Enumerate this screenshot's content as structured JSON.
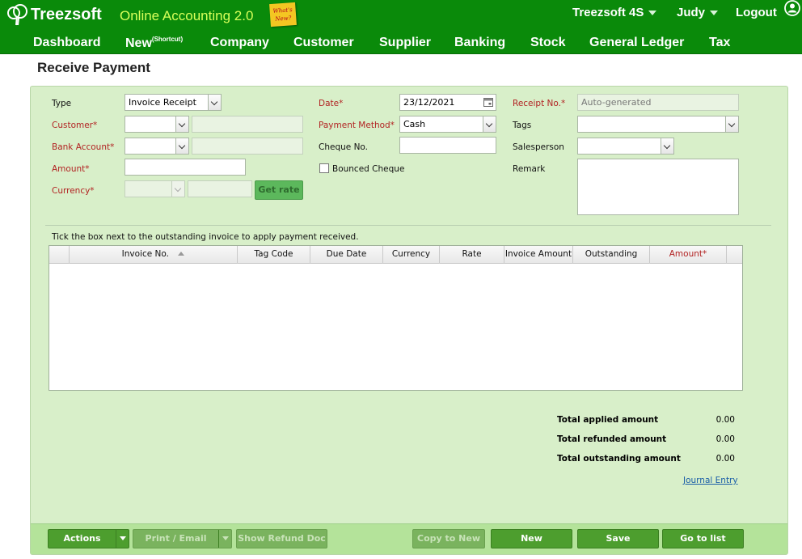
{
  "header": {
    "brand": "Treezsoft",
    "tagline": "Online Accounting 2.0",
    "whats_new": "What's New?",
    "company": "Treezsoft 4S",
    "user": "Judy",
    "logout": "Logout"
  },
  "nav": {
    "items": [
      "Dashboard",
      "New",
      "Company",
      "Customer",
      "Supplier",
      "Banking",
      "Stock",
      "General Ledger",
      "Tax"
    ],
    "new_suffix": "(Shortcut)"
  },
  "page": {
    "title": "Receive Payment"
  },
  "form": {
    "type_label": "Type",
    "type_value": "Invoice Receipt",
    "customer_label": "Customer*",
    "customer_value": "",
    "bank_account_label": "Bank Account*",
    "bank_account_value": "",
    "amount_label": "Amount*",
    "amount_value": "",
    "currency_label": "Currency*",
    "currency_value": "",
    "get_rate": "Get rate",
    "date_label": "Date*",
    "date_value": "23/12/2021",
    "payment_method_label": "Payment Method*",
    "payment_method_value": "Cash",
    "cheque_label": "Cheque No.",
    "cheque_value": "",
    "bounced_label": "Bounced Cheque",
    "receipt_label": "Receipt No.*",
    "receipt_placeholder": "Auto-generated",
    "tags_label": "Tags",
    "tags_value": "",
    "salesperson_label": "Salesperson",
    "salesperson_value": "",
    "remark_label": "Remark",
    "remark_value": ""
  },
  "grid": {
    "instruction": "Tick the box next to the outstanding invoice to apply payment received.",
    "columns": [
      "Invoice No.",
      "Tag Code",
      "Due Date",
      "Currency",
      "Rate",
      "Invoice Amount",
      "Outstanding",
      "Amount*"
    ],
    "rows": []
  },
  "totals": {
    "applied_label": "Total applied amount",
    "applied_value": "0.00",
    "refunded_label": "Total refunded amount",
    "refunded_value": "0.00",
    "outstanding_label": "Total outstanding amount",
    "outstanding_value": "0.00",
    "journal_entry": "Journal Entry"
  },
  "buttons": {
    "actions": "Actions",
    "print_email": "Print / Email",
    "show_refund_doc": "Show Refund Doc",
    "copy_to_new": "Copy to New",
    "new": "New",
    "save": "Save",
    "go_to_list": "Go to list"
  },
  "colors": {
    "header_green": "#0a8a0a",
    "panel_green": "#d8efc9",
    "button_green": "#4d9e2e",
    "required_red": "#b22222"
  }
}
